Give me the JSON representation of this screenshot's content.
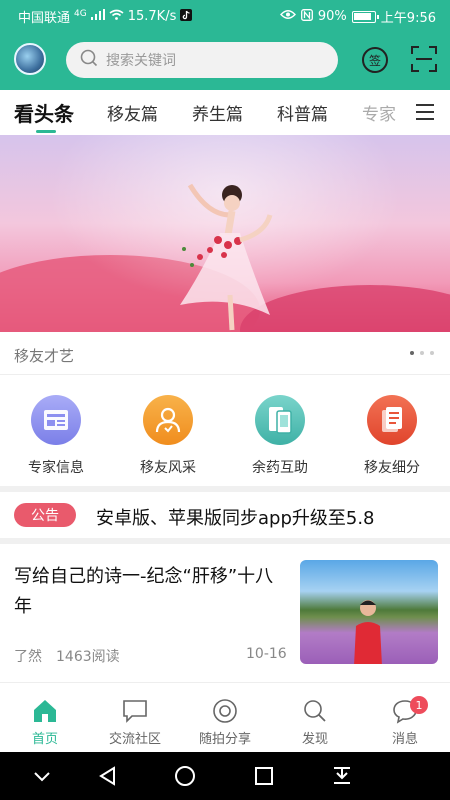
{
  "status_bar": {
    "carrier": "中国联通",
    "network": "4G",
    "speed": "15.7K/s",
    "battery": "90%",
    "time": "上午9:56"
  },
  "header": {
    "search_placeholder": "搜索关键词",
    "sign_label": "签"
  },
  "tabs": [
    {
      "label": "看头条",
      "active": true
    },
    {
      "label": "移友篇"
    },
    {
      "label": "养生篇"
    },
    {
      "label": "科普篇"
    },
    {
      "label": "专家"
    }
  ],
  "banner": {
    "caption": "移友才艺",
    "dots_total": 3,
    "dots_active": 1
  },
  "shortcuts": [
    {
      "label": "专家信息",
      "icon": "document-icon",
      "color": "#8c8ff0"
    },
    {
      "label": "移友风采",
      "icon": "user-icon",
      "color": "#f39a2c"
    },
    {
      "label": "余药互助",
      "icon": "phone-pair-icon",
      "color": "#4fbdb3"
    },
    {
      "label": "移友细分",
      "icon": "list-doc-icon",
      "color": "#e8553a"
    }
  ],
  "notice": {
    "tag": "公告",
    "text": "安卓版、苹果版同步app升级至5.8"
  },
  "article": {
    "title": "写给自己的诗一-纪念“肝移”十八年",
    "author": "了然",
    "reads": "1463阅读",
    "date": "10-16"
  },
  "bottom_nav": [
    {
      "label": "首页",
      "icon": "home-icon",
      "active": true
    },
    {
      "label": "交流社区",
      "icon": "chat-icon"
    },
    {
      "label": "随拍分享",
      "icon": "camera-icon"
    },
    {
      "label": "发现",
      "icon": "search-icon"
    },
    {
      "label": "消息",
      "icon": "message-icon",
      "badge": "1"
    }
  ],
  "colors": {
    "brand": "#2bb895",
    "notice_tag": "#e95a6c",
    "badge": "#ee4c5b"
  }
}
